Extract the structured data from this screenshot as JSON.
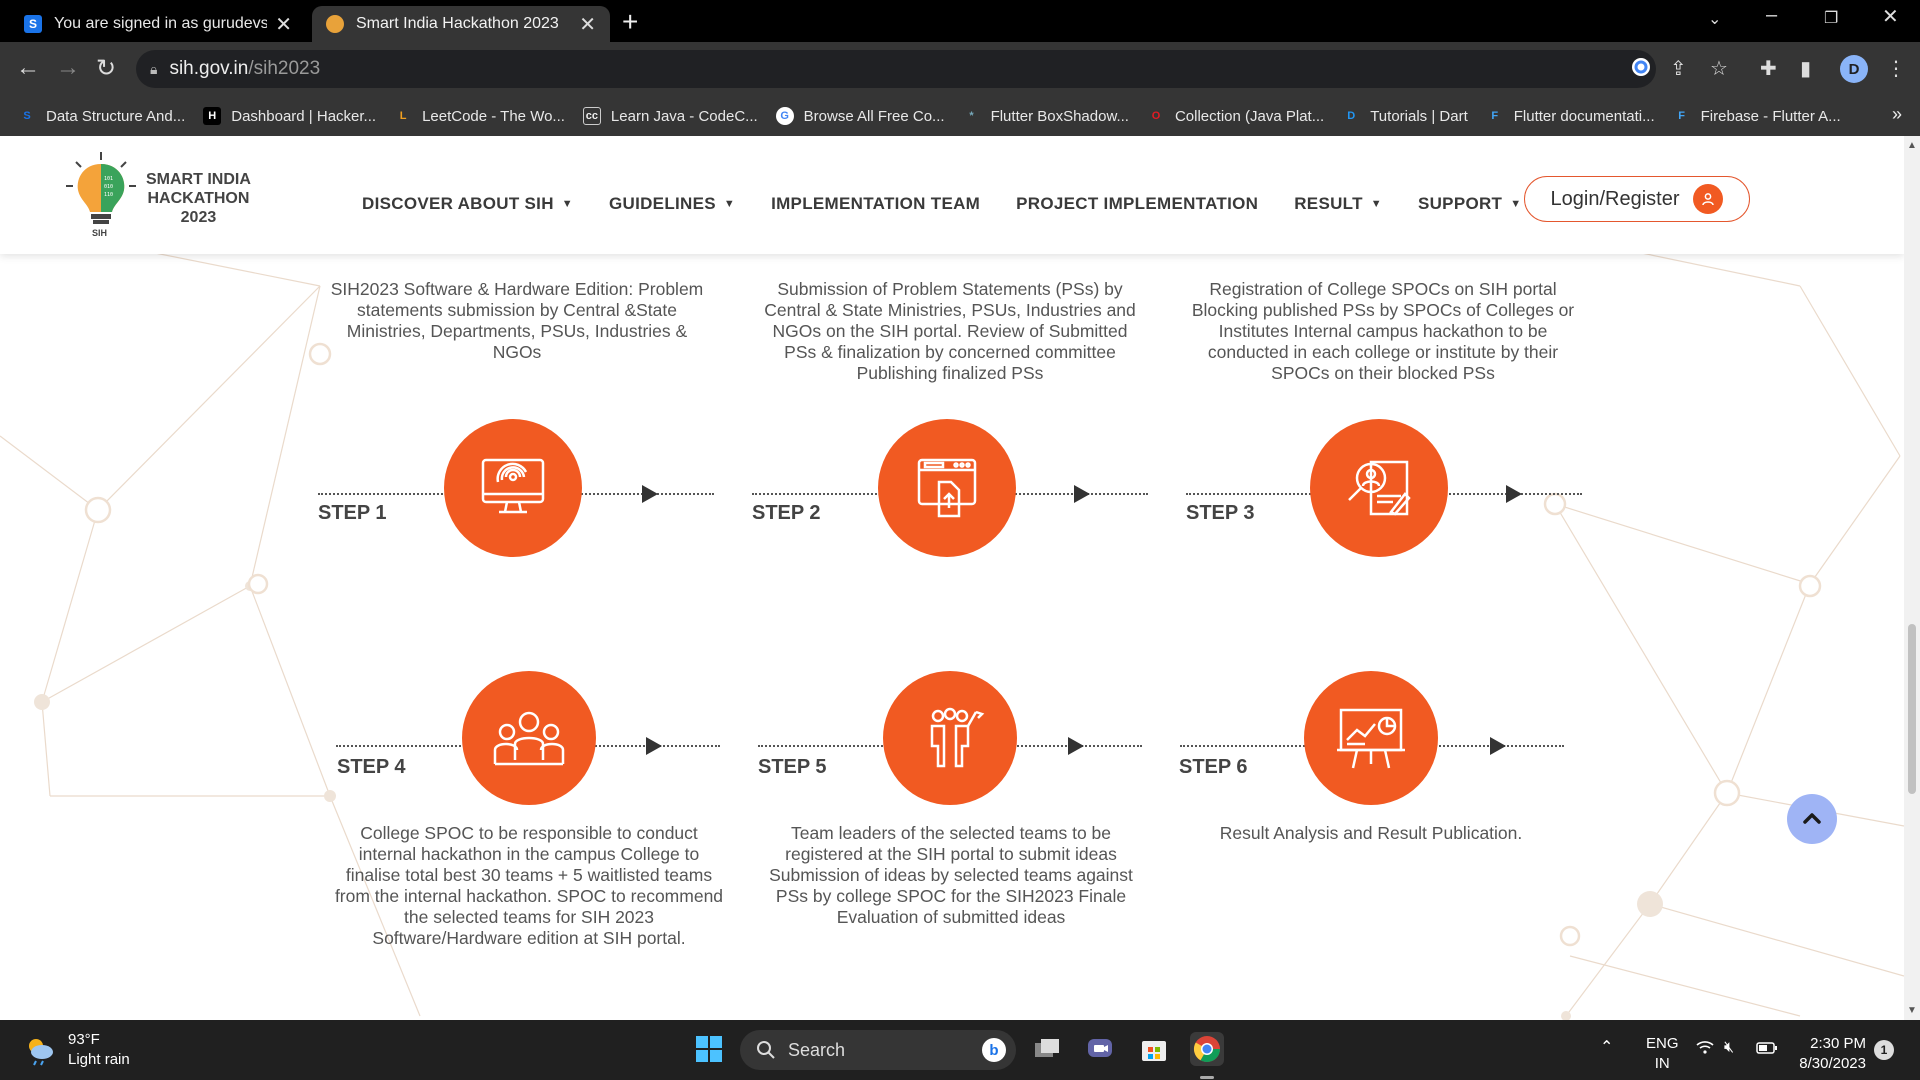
{
  "browser": {
    "tabs": [
      {
        "title": "You are signed in as gurudevsingh",
        "favicon": "S",
        "active": false
      },
      {
        "title": "Smart India Hackathon 2023",
        "favicon": "",
        "active": true
      }
    ],
    "url_host": "sih.gov.in",
    "url_path": "/sih2023",
    "profile_initial": "D",
    "bookmarks": [
      {
        "label": "Data Structure And...",
        "icon": "S"
      },
      {
        "label": "Dashboard | Hacker...",
        "icon": "H"
      },
      {
        "label": "LeetCode - The Wo...",
        "icon": "L"
      },
      {
        "label": "Learn Java - CodeC...",
        "icon": "cc"
      },
      {
        "label": "Browse All Free Co...",
        "icon": "G"
      },
      {
        "label": "Flutter BoxShadow...",
        "icon": "*"
      },
      {
        "label": "Collection (Java Plat...",
        "icon": "O"
      },
      {
        "label": "Tutorials | Dart",
        "icon": "D"
      },
      {
        "label": "Flutter documentati...",
        "icon": "F"
      },
      {
        "label": "Firebase - Flutter A...",
        "icon": "F"
      }
    ],
    "bookmarks_more": "»"
  },
  "header": {
    "logo_line1": "SMART INDIA",
    "logo_line2": "HACKATHON",
    "logo_line3": "2023",
    "logo_badge": "SIH",
    "nav": [
      {
        "label": "DISCOVER ABOUT SIH",
        "caret": true
      },
      {
        "label": "GUIDELINES",
        "caret": true
      },
      {
        "label": "IMPLEMENTATION TEAM",
        "caret": false
      },
      {
        "label": "PROJECT IMPLEMENTATION",
        "caret": false
      },
      {
        "label": "RESULT",
        "caret": true
      },
      {
        "label": "SUPPORT",
        "caret": true
      }
    ],
    "login_label": "Login/Register"
  },
  "steps": [
    {
      "label": "STEP 1",
      "icon": "monitor-fingerprint-icon",
      "text": "SIH2023 Software & Hardware Edition: Problem statements submission by Central &State Ministries, Departments, PSUs, Industries & NGOs"
    },
    {
      "label": "STEP 2",
      "icon": "upload-document-icon",
      "text": "Submission of Problem Statements (PSs) by Central & State Ministries, PSUs, Industries and NGOs on the SIH portal. Review of Submitted PSs & finalization by concerned committee Publishing finalized PSs"
    },
    {
      "label": "STEP 3",
      "icon": "search-profile-icon",
      "text": "Registration of College SPOCs on SIH portal Blocking published PSs by SPOCs of Colleges or Institutes Internal campus hackathon to be conducted in each college or institute by their SPOCs on their blocked PSs"
    },
    {
      "label": "STEP 4",
      "icon": "team-group-icon",
      "text": "College SPOC to be responsible to conduct internal hackathon in the campus College to finalise total best 30 teams + 5 waitlisted teams from the internal hackathon. SPOC to recommend the selected teams for SIH 2023 Software/Hardware edition at SIH portal."
    },
    {
      "label": "STEP 5",
      "icon": "team-leaders-icon",
      "text": "Team leaders of the selected teams to be registered at the SIH portal to submit ideas Submission of ideas by selected teams against PSs by college SPOC for the SIH2023 Finale Evaluation of submitted ideas"
    },
    {
      "label": "STEP 6",
      "icon": "analytics-board-icon",
      "text": "Result Analysis and Result Publication."
    }
  ],
  "taskbar": {
    "temperature": "93°F",
    "weather": "Light rain",
    "search_placeholder": "Search",
    "lang_line1": "ENG",
    "lang_line2": "IN",
    "time": "2:30 PM",
    "date": "8/30/2023",
    "notification_count": "1"
  },
  "colors": {
    "accent": "#f15a22",
    "totop": "#9fb4f5"
  }
}
